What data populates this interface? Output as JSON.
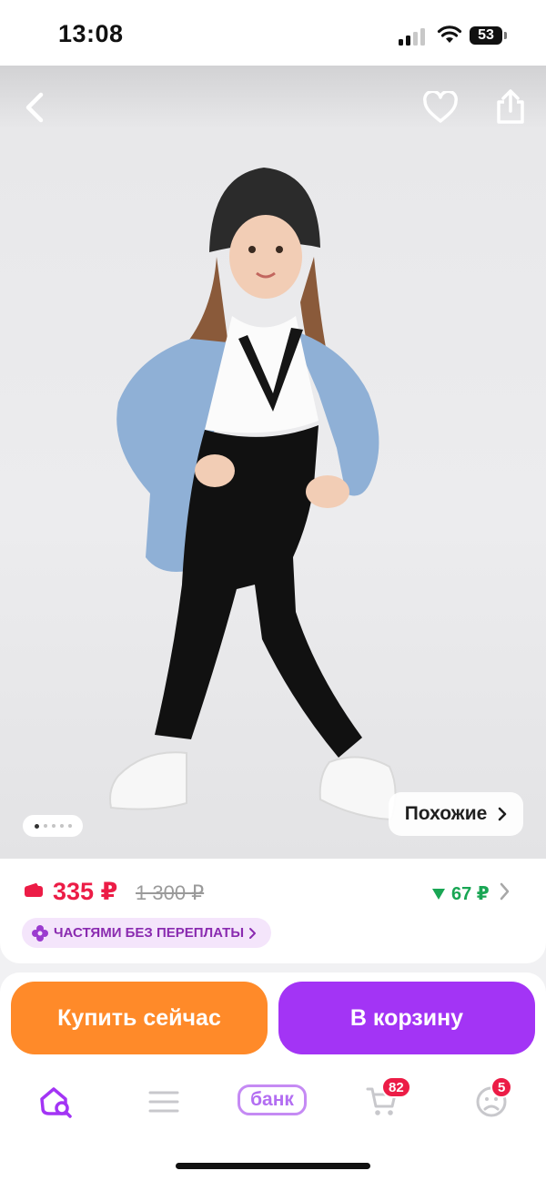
{
  "status_bar": {
    "time": "13:08",
    "battery": "53"
  },
  "gallery": {
    "image_alt": "Product photo",
    "pager_count": 5,
    "pager_active": 0,
    "similar_label": "Похожие"
  },
  "price": {
    "current": "335 ₽",
    "old": "1 300 ₽",
    "bonus": "67 ₽",
    "installment_label": "ЧАСТЯМИ БЕЗ ПЕРЕПЛАТЫ"
  },
  "actions": {
    "buy_now_label": "Купить сейчас",
    "to_cart_label": "В корзину"
  },
  "bottom_nav": {
    "bank_label": "банк",
    "cart_badge": "82",
    "profile_badge": "5"
  },
  "colors": {
    "accent_purple": "#a334f5",
    "buy_orange": "#ff8a29",
    "price_red": "#ec1c46",
    "bonus_green": "#19a654"
  }
}
